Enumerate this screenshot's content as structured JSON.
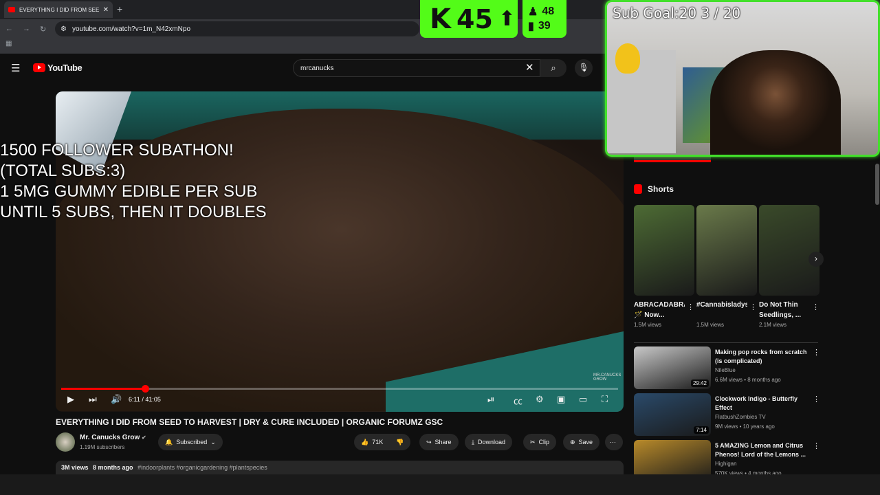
{
  "browser": {
    "tab_title": "EVERYTHING I DID FROM SEED",
    "tab_close": "✕",
    "new_tab": "+",
    "url": "youtube.com/watch?v=1m_N42xmNpo"
  },
  "youtube": {
    "logo_text": "YouTube",
    "search_value": "mrcanucks",
    "clear_icon": "✕",
    "search_icon": "⌕",
    "mic_icon": "🎙"
  },
  "overlay": {
    "subathon_text": "1500 FOLLOWER SUBATHON!\n(TOTAL SUBS:3)\n1 5MG GUMMY EDIBLE PER SUB\nUNTIL 5 SUBS, THEN IT DOUBLES"
  },
  "kick": {
    "logo": "K",
    "count": "45",
    "arrow": "⬆",
    "followers": "48",
    "viewers": "39"
  },
  "webcam": {
    "sub_goal": "Sub Goal:20  3 / 20"
  },
  "player": {
    "time": "6:11 / 41:05",
    "progress_fraction": 0.15,
    "watermark": "MR.CANUCKS GROW"
  },
  "video": {
    "title": "EVERYTHING I DID FROM SEED TO HARVEST | DRY & CURE INCLUDED | ORGANIC FORUMZ GSC",
    "channel": "Mr. Canucks Grow",
    "subscribers": "1.19M subscribers",
    "subscribed_label": "Subscribed",
    "likes": "71K",
    "share_label": "Share",
    "download_label": "Download",
    "clip_label": "Clip",
    "save_label": "Save",
    "views": "3M views",
    "age": "8 months ago",
    "hashtags": "#indoorplants #organicgardening #plantspecies"
  },
  "sidebar": {
    "shorts_heading": "Shorts",
    "shorts": [
      {
        "title": "ABRACADABRA 🪄 Now...",
        "views": "1.5M views",
        "color": "#4d6b34"
      },
      {
        "title": "#Cannabisladys,#Toppi...",
        "views": "1.5M views",
        "color": "#6a7a4a"
      },
      {
        "title": "Do Not Thin Seedlings, ...",
        "views": "2.1M views",
        "color": "#3a4a2a"
      }
    ],
    "recommended": [
      {
        "title": "Making pop rocks from scratch (is complicated)",
        "channel": "NileBlue",
        "meta": "6.6M views • 8 months ago",
        "duration": "29:42",
        "color": "#c9c9c9"
      },
      {
        "title": "Clockwork Indigo - Butterfly Effect",
        "channel": "FlatbushZombies TV",
        "meta": "9M views • 10 years ago",
        "duration": "7:14",
        "color": "#2a4a6a"
      },
      {
        "title": "5 AMAZING Lemon and Citrus Phenos! Lord of the Lemons ...",
        "channel": "Highigan",
        "meta": "570K views • 4 months ago",
        "duration": "",
        "color": "#b88a2a"
      }
    ]
  }
}
